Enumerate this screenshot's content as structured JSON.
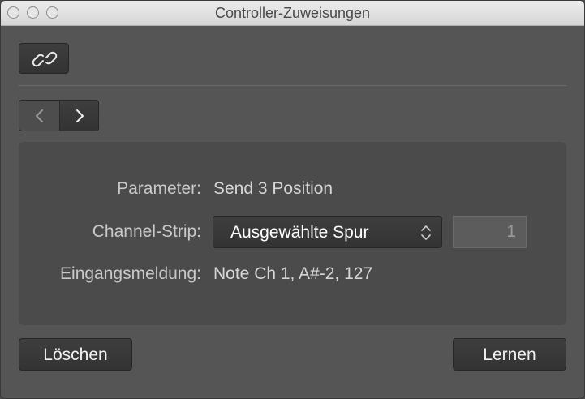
{
  "window": {
    "title": "Controller-Zuweisungen"
  },
  "toolbar": {
    "link_icon": "link-icon"
  },
  "nav": {
    "prev_icon": "chevron-left-icon",
    "next_icon": "chevron-right-icon"
  },
  "fields": {
    "parameter_label": "Parameter:",
    "parameter_value": "Send 3 Position",
    "channel_strip_label": "Channel-Strip:",
    "channel_strip_value": "Ausgewählte Spur",
    "channel_number": "1",
    "input_message_label": "Eingangsmeldung:",
    "input_message_value": "Note Ch 1, A#-2, 127"
  },
  "buttons": {
    "delete": "Löschen",
    "learn": "Lernen"
  },
  "colors": {
    "window_bg": "#555555",
    "panel_bg": "#4b4b4b",
    "button_bg": "#363636"
  }
}
